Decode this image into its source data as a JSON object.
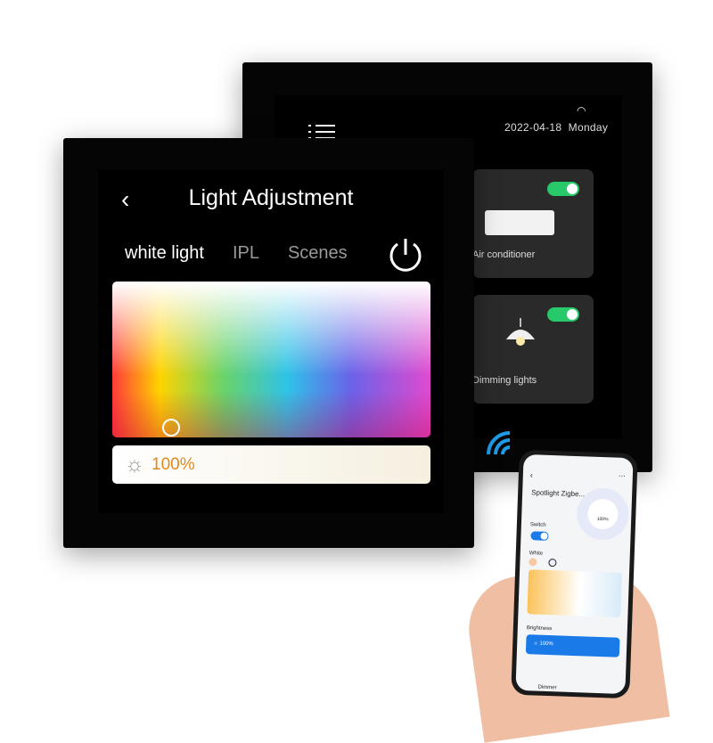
{
  "back_panel": {
    "date": "2022-04-18",
    "weekday": "Monday",
    "cards": [
      {
        "label": "Air conditioner",
        "on": true
      },
      {
        "label": "Dimming lights",
        "on": true
      }
    ]
  },
  "front_panel": {
    "title": "Light Adjustment",
    "tabs": [
      "white light",
      "IPL",
      "Scenes"
    ],
    "brightness": "100%"
  },
  "phone": {
    "device": "Spotlight Zigbe...",
    "ring_value": "100%",
    "switch_label": "Switch",
    "white_label": "White",
    "brightness_label": "Brightness",
    "brightness": "100%",
    "bottom_tab": "Dimmer"
  },
  "colors": {
    "accent_green": "#28c96a",
    "accent_blue": "#1a7be8",
    "brightness_orange": "#e08a1e"
  }
}
